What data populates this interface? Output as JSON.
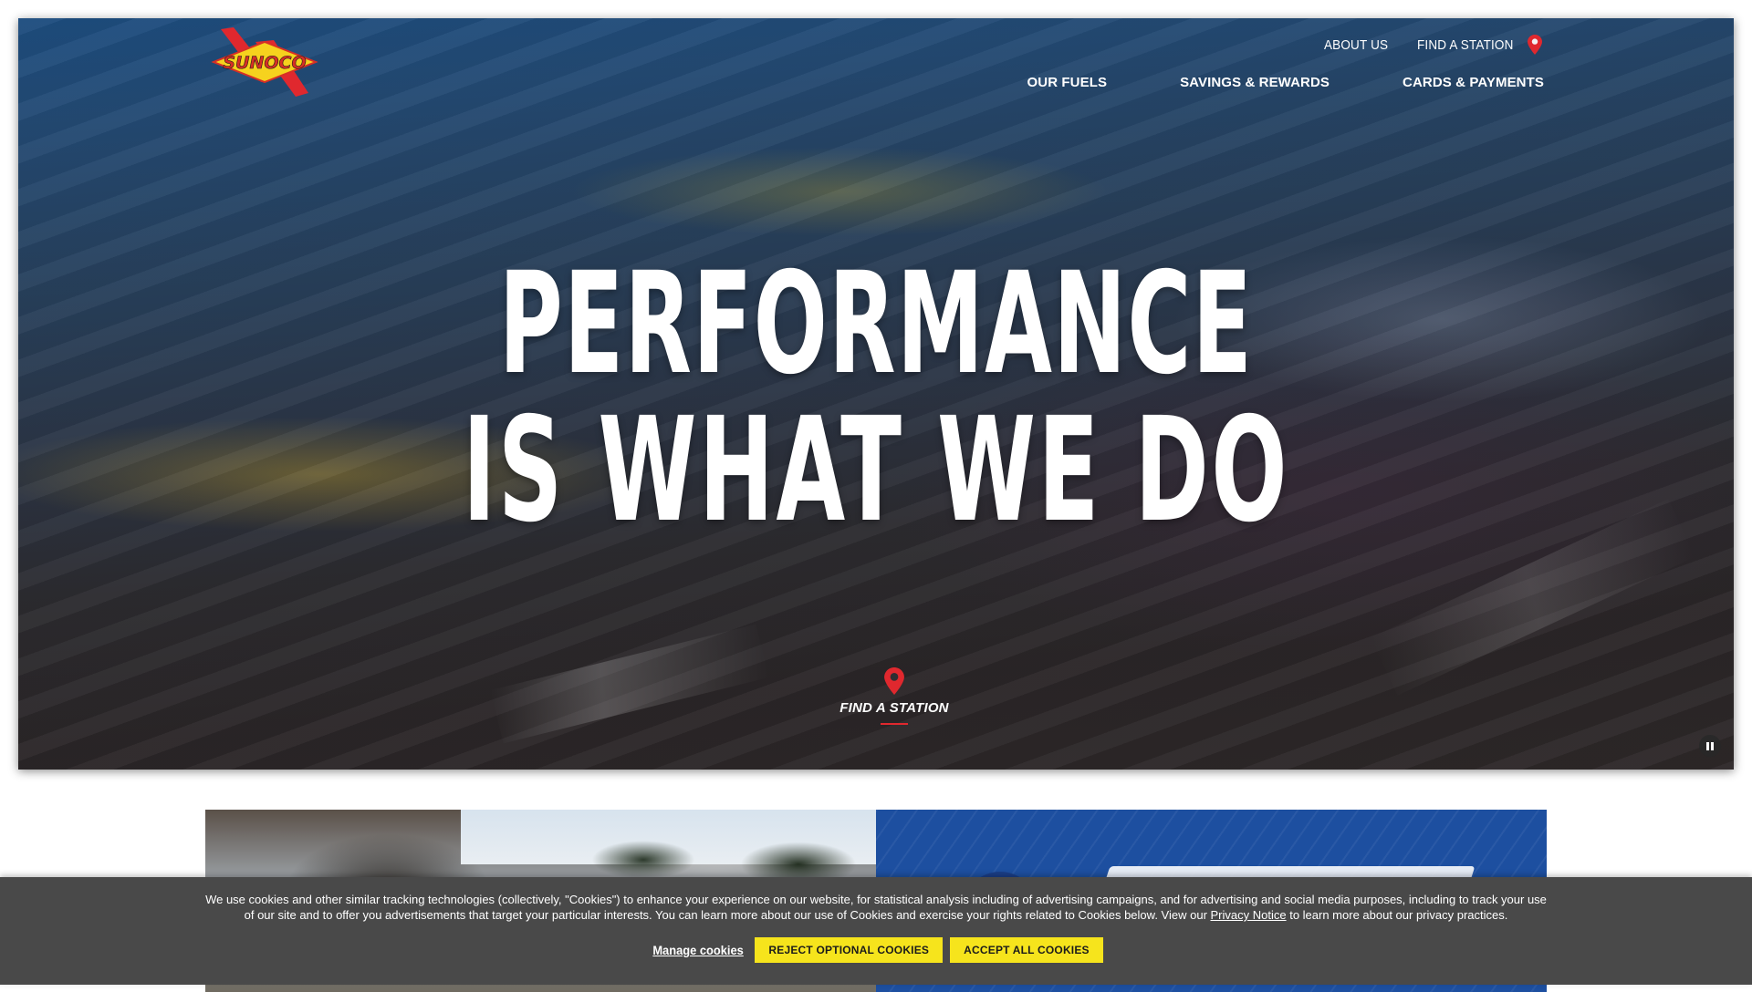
{
  "brand": {
    "logo_text": "SUNOCO",
    "colors": {
      "red": "#e0282e",
      "yellow": "#f6d21e",
      "blue": "#1d4fa0",
      "cookie_bg": "#494949",
      "cookie_btn": "#f6e41c"
    }
  },
  "header": {
    "utility_nav": {
      "about": "ABOUT US",
      "find_station": "FIND A STATION",
      "find_icon": "map-pin-icon"
    },
    "main_nav": [
      {
        "label": "OUR FUELS"
      },
      {
        "label": "SAVINGS & REWARDS"
      },
      {
        "label": "CARDS & PAYMENTS"
      }
    ]
  },
  "hero": {
    "headline_line1": "PERFORMANCE",
    "headline_line2": "IS WHAT WE DO",
    "cta_label": "FIND A STATION",
    "cta_icon": "map-pin-icon",
    "pause_icon": "pause-icon"
  },
  "cookie_banner": {
    "text_before_link": "We use cookies and other similar tracking technologies (collectively, \"Cookies\") to enhance your experience on our website, for statistical analysis including of advertising campaigns, and for advertising and social media purposes, including to track your use of our site and to offer you advertisements that target your particular interests. You can learn more about our use of Cookies and exercise your rights related to Cookies below. View our ",
    "link_text": "Privacy Notice",
    "text_after_link": " to learn more about our privacy practices.",
    "manage_label": "Manage cookies",
    "reject_label": "REJECT OPTIONAL COOKIES",
    "accept_label": "ACCEPT ALL COOKIES"
  }
}
